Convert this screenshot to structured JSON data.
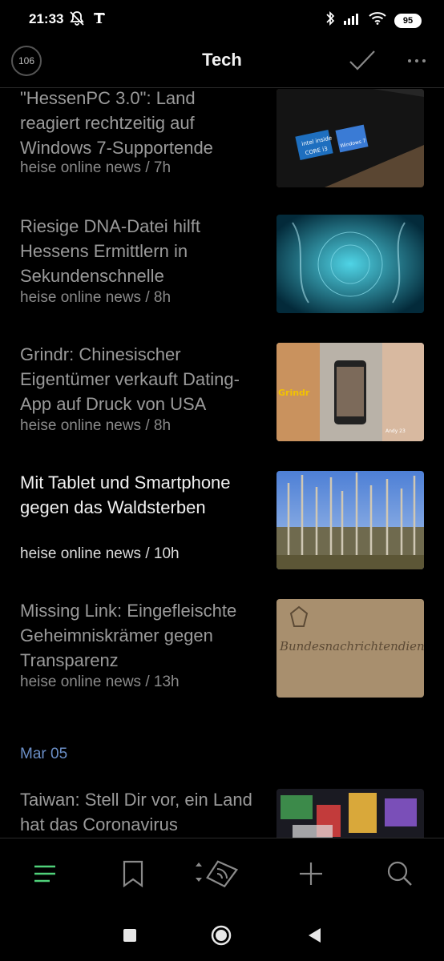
{
  "status_bar": {
    "time": "21:33",
    "battery": "95",
    "icons": [
      "bell-off-icon",
      "nyt-icon",
      "bluetooth-icon",
      "signal-icon",
      "wifi-icon",
      "battery-icon"
    ]
  },
  "header": {
    "unread_count": "106",
    "title": "Tech",
    "icons": [
      "check-icon",
      "more-icon"
    ]
  },
  "articles": [
    {
      "title": "\"HessenPC 3.0\": Land reagiert rechtzeitig auf Windows 7-Supportende",
      "meta": "heise online news / 7h",
      "read": true
    },
    {
      "title": "Riesige DNA-Datei hilft Hessens Ermittlern in Sekundenschnelle",
      "meta": "heise online news / 8h",
      "read": true
    },
    {
      "title": "Grindr: Chinesischer Eigentümer verkauft Dating-App auf Druck von USA",
      "meta": "heise online news / 8h",
      "read": true
    },
    {
      "title": "Mit Tablet und Smartphone gegen das Waldsterben",
      "meta": "heise online news / 10h",
      "read": false
    },
    {
      "title": "Missing Link: Eingefleischte Geheimniskrämer gegen Transparenz",
      "meta": "heise online news / 13h",
      "read": true
    },
    {
      "title": "Taiwan: Stell Dir vor, ein Land hat das Coronavirus",
      "meta": "",
      "read": true
    }
  ],
  "thumbnail_text": {
    "intel": "intel inside",
    "core": "CORE i3",
    "windows": "Windows 7",
    "grindr": "Grindr",
    "grindr_caption": "Andy 23",
    "bnd": "Bundesnachrichtendienst"
  },
  "date_header": "Mar 05",
  "bottom_nav": [
    "menu-icon",
    "bookmark-icon",
    "feed-sort-icon",
    "add-icon",
    "search-icon"
  ],
  "colors": {
    "accent": "#4fd17a",
    "date_header": "#6b8fc7",
    "background": "#000000"
  }
}
